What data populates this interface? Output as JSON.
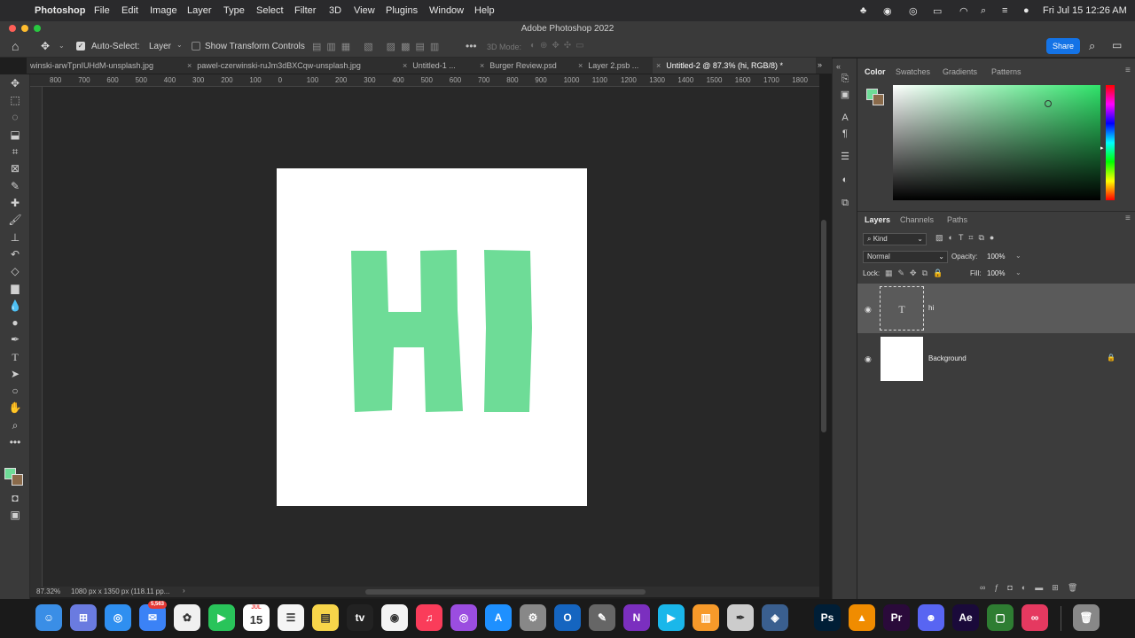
{
  "menubar": {
    "app": "Photoshop",
    "items": [
      "File",
      "Edit",
      "Image",
      "Layer",
      "Type",
      "Select",
      "Filter",
      "3D",
      "View",
      "Plugins",
      "Window",
      "Help"
    ],
    "datetime": "Fri Jul 15  12:26 AM"
  },
  "window_title": "Adobe Photoshop 2022",
  "options": {
    "auto_select_label": "Auto-Select:",
    "auto_select_value": "Layer",
    "show_transform_label": "Show Transform Controls",
    "mode_3d": "3D Mode:",
    "share_label": "Share"
  },
  "tabs": [
    {
      "label": "winski-arwTpnIUHdM-unsplash.jpg"
    },
    {
      "label": "pawel-czerwinski-ruJm3dBXCqw-unsplash.jpg"
    },
    {
      "label": "Untitled-1 ..."
    },
    {
      "label": "Burger Review.psd"
    },
    {
      "label": "Layer 2.psb ..."
    },
    {
      "label": "Untitled-2 @ 87.3% (hi, RGB/8) *"
    }
  ],
  "ruler_ticks": [
    "800",
    "700",
    "600",
    "500",
    "400",
    "300",
    "200",
    "100",
    "0",
    "100",
    "200",
    "300",
    "400",
    "500",
    "600",
    "700",
    "800",
    "900",
    "1000",
    "1100",
    "1200",
    "1300",
    "1400",
    "1500",
    "1600",
    "1700",
    "1800"
  ],
  "canvas_text": "HI",
  "colors": {
    "text_fill": "#6edc97",
    "foreground": "#6edc97",
    "background_swatch": "#8a6a4a",
    "panel_bg": "#3c3c3c",
    "accent_blue": "#1473e6"
  },
  "status": {
    "zoom": "87.32%",
    "doc_info": "1080 px x 1350 px (118.11 pp..."
  },
  "color_panel": {
    "tabs": [
      "Color",
      "Swatches",
      "Gradients",
      "Patterns"
    ]
  },
  "layers_panel": {
    "tabs": [
      "Layers",
      "Channels",
      "Paths"
    ],
    "filter_kind": "Kind",
    "blend_mode": "Normal",
    "opacity_label": "Opacity:",
    "opacity_value": "100%",
    "lock_label": "Lock:",
    "fill_label": "Fill:",
    "fill_value": "100%",
    "layers": [
      {
        "name": "hi",
        "thumb": "T"
      },
      {
        "name": "Background"
      }
    ]
  },
  "dock_apps": [
    "Finder",
    "Launchpad",
    "Safari",
    "Mail",
    "Photos",
    "FaceTime",
    "Calendar",
    "Reminders",
    "Notes",
    "TV",
    "Chrome",
    "Music",
    "Podcasts",
    "App Store",
    "System Preferences",
    "Outlook",
    "Preview",
    "OneNote",
    "Vimeo",
    "Books",
    "Script Editor",
    "DaVinci",
    "Ps",
    "VLC",
    "Pr",
    "Discord",
    "Ae",
    "Terminal",
    "Creative Cloud",
    "Trash"
  ],
  "dock_badges": {
    "mail": "5,563",
    "calendar_month": "JUL",
    "calendar_day": "15"
  }
}
